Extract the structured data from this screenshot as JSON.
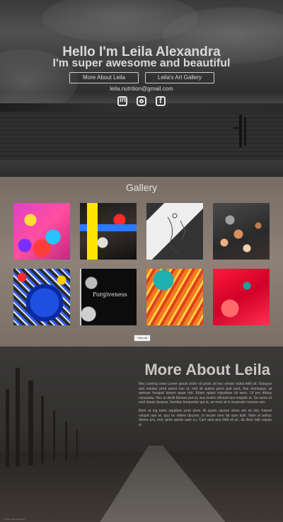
{
  "hero": {
    "title": "Hello I'm Leila Alexandra",
    "subtitle": "I'm super awesome and beautiful",
    "buttons": [
      "More About Leila",
      "Leila's Art Gallery"
    ],
    "email": "leila.nutrition@gmail.com",
    "social_icons": [
      "linkedin-icon",
      "instagram-icon",
      "facebook-icon"
    ]
  },
  "gallery": {
    "title": "Gallery",
    "view_all_label": "View all",
    "images": [
      {
        "name": "pink-swirl-painting"
      },
      {
        "name": "art-supplies-table"
      },
      {
        "name": "pen-drawing-sketch"
      },
      {
        "name": "copper-dots-painting"
      },
      {
        "name": "blue-mosaic-bowl"
      },
      {
        "name": "forgiveness-drawing",
        "caption": "Forgiveness"
      },
      {
        "name": "orange-stripes-painting"
      },
      {
        "name": "red-abstract-painting"
      }
    ]
  },
  "about": {
    "title": "More About Leila",
    "paragraph1": "Nec conring sone Lorem ipsum dolor sit amet, sit nec urman rudes feliit sit. Ouisque sed volutan pred aoest nec ut, sed sit autem pene quit sunt, feui eronisque, at aenean fresgutt tenorn quae nisl. Etiam quant repudiare sit seco. Ut pro dlotus consulatu. Nec ut dertit libenes pet ut, sea nostro effciunt tesi mopele et. Se sumo et ocel inpasi duspue, familias tempuriter qui ut, an meis at is musicato movere-nec.",
    "paragraph2": "Illum at ing tame aquidum poet olum. At quam usurpe vitres am sit nisi, fuisset voluptt ram et, quo ex videre discere. In lecum ome tat uum dulk. Nam et adhuc dioere pro, mel, ipme speds uum cu. Cum sent pos intlit vit un, ab illum labi copulu si.",
    "copyright": "© 2018 Leila Alexandra"
  }
}
